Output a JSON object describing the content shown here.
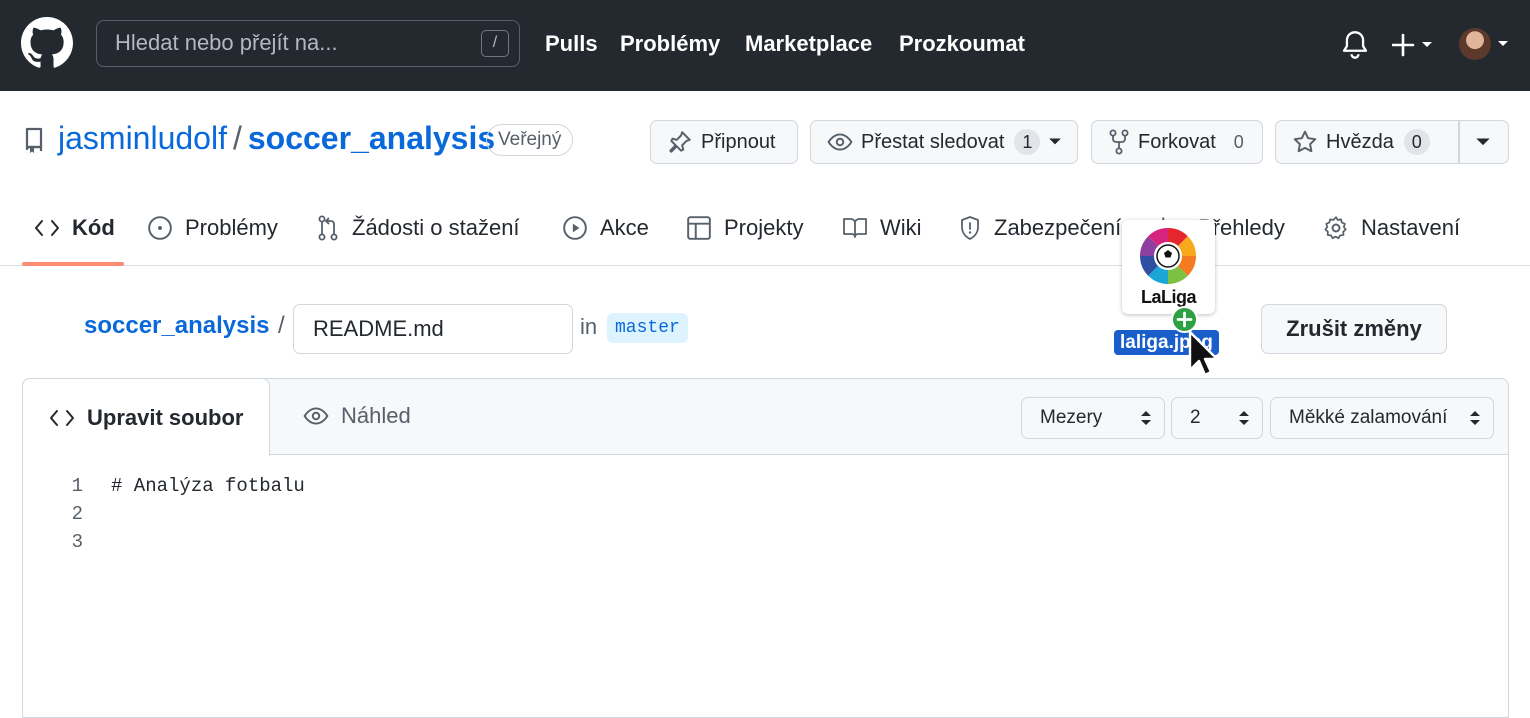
{
  "header": {
    "search_placeholder": "Hledat nebo přejít na...",
    "search_shortcut": "/",
    "nav": [
      "Pulls",
      "Problémy",
      "Marketplace",
      "Prozkoumat"
    ]
  },
  "repo": {
    "owner": "jasminludolf",
    "separator": "/",
    "name": "soccer_analysis",
    "visibility": "Veřejný",
    "actions": {
      "pin_label": "Připnout",
      "watch_label": "Přestat sledovat",
      "watch_count": "1",
      "fork_label": "Forkovat",
      "fork_count": "0",
      "star_label": "Hvězda",
      "star_count": "0"
    }
  },
  "tabs": [
    {
      "label": "Kód",
      "icon": "code-icon"
    },
    {
      "label": "Problémy",
      "icon": "issue-icon"
    },
    {
      "label": "Žádosti o stažení",
      "icon": "pull-request-icon"
    },
    {
      "label": "Akce",
      "icon": "play-icon"
    },
    {
      "label": "Projekty",
      "icon": "table-icon"
    },
    {
      "label": "Wiki",
      "icon": "book-icon"
    },
    {
      "label": "Zabezpečení",
      "icon": "shield-icon"
    },
    {
      "label": "Přehledy",
      "icon": "graph-icon"
    },
    {
      "label": "Nastavení",
      "icon": "gear-icon"
    }
  ],
  "breadcrumb": {
    "repo": "soccer_analysis",
    "separator": "/",
    "filename": "README.md",
    "in_text": "in",
    "branch": "master",
    "cancel_label": "Zrušit změny"
  },
  "drag": {
    "logo_text": "LaLiga",
    "file_name": "laliga.jpeg"
  },
  "editor": {
    "edit_tab": "Upravit soubor",
    "preview_tab": "Náhled",
    "indent_mode": "Mezery",
    "indent_size": "2",
    "wrap_mode": "Měkké zalamování",
    "lines": [
      {
        "num": "1",
        "text": "# Analýza fotbalu"
      },
      {
        "num": "2",
        "text": ""
      },
      {
        "num": "3",
        "text": ""
      }
    ]
  },
  "colors": {
    "header_bg": "#24292f",
    "link": "#0969da",
    "active_tab_underline": "#fd8c73",
    "drag_label_bg": "#1a5fc9"
  }
}
